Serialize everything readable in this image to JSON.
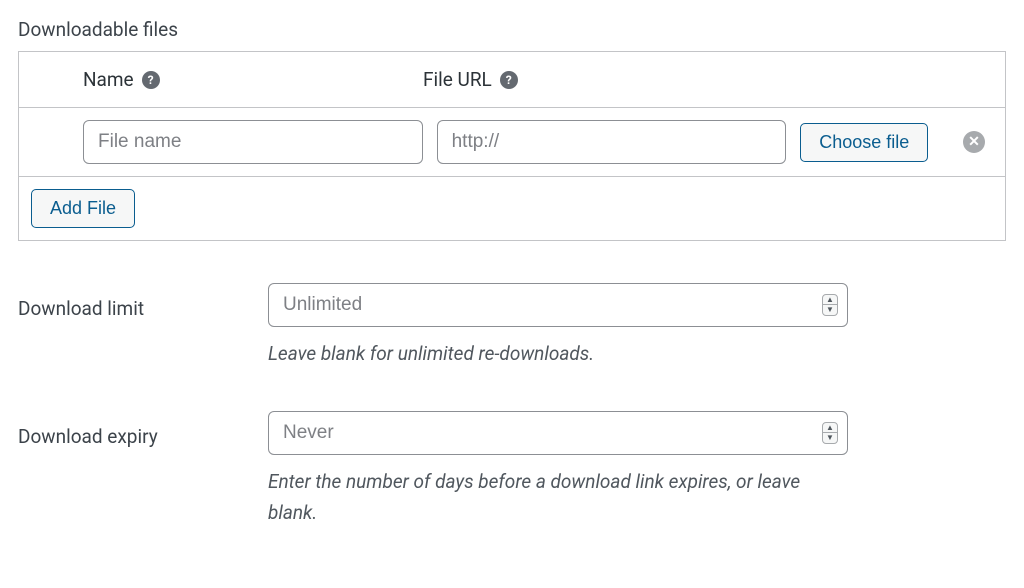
{
  "section": {
    "title": "Downloadable files"
  },
  "table": {
    "headers": {
      "name": "Name",
      "url": "File URL"
    },
    "row": {
      "name_placeholder": "File name",
      "name_value": "",
      "url_placeholder": "http://",
      "url_value": "",
      "choose_file_label": "Choose file"
    },
    "add_file_label": "Add File"
  },
  "download_limit": {
    "label": "Download limit",
    "placeholder": "Unlimited",
    "value": "",
    "help": "Leave blank for unlimited re-downloads."
  },
  "download_expiry": {
    "label": "Download expiry",
    "placeholder": "Never",
    "value": "",
    "help": "Enter the number of days before a download link expires, or leave blank."
  },
  "icons": {
    "help": "?",
    "delete": "✕"
  }
}
